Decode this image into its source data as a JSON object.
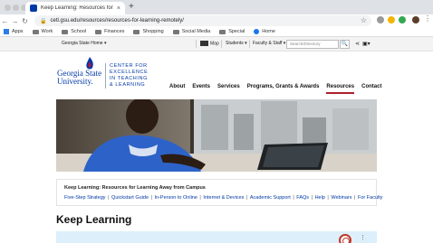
{
  "browser": {
    "tab_title": "Keep Learning: Resources for",
    "tab_close": "×",
    "new_tab": "+",
    "url": "cetl.gsu.edu/resources/resources-for-learning-remotely/",
    "nav": {
      "back": "←",
      "forward": "→",
      "reload": "↻"
    },
    "bookmarks": [
      {
        "label": "Apps",
        "icon": "apps-grid-icon"
      },
      {
        "label": "Work",
        "icon": "folder-icon"
      },
      {
        "label": "School",
        "icon": "folder-icon"
      },
      {
        "label": "Finances",
        "icon": "folder-icon"
      },
      {
        "label": "Shopping",
        "icon": "folder-icon"
      },
      {
        "label": "Social Media",
        "icon": "folder-icon"
      },
      {
        "label": "Special",
        "icon": "folder-icon"
      },
      {
        "label": "Home",
        "icon": "facebook-icon"
      }
    ]
  },
  "utility": {
    "gsu_home": "Georgia State Home ▾",
    "map": "Map",
    "students": "Students ▾",
    "faculty": "Faculty & Staff ▾",
    "search_placeholder": "Search/Directory",
    "search_icon": "🔍"
  },
  "logo": {
    "university": "Georgia State University.",
    "center_line1": "CENTER FOR",
    "center_line2": "EXCELLENCE",
    "center_line3": "IN TEACHING",
    "center_line4": "& LEARNING"
  },
  "nav": [
    "About",
    "Events",
    "Services",
    "Programs, Grants & Awards",
    "Resources",
    "Contact"
  ],
  "quick": {
    "title": "Keep Learning: Resources for Learning Away from Campus",
    "links": [
      "Five-Step Strategy",
      "Quickstart Guide",
      "In-Person to Online",
      "Internet & Devices",
      "Academic Support",
      "FAQs",
      "Help",
      "Webinars",
      "For Faculty"
    ]
  },
  "page_title": "Keep Learning",
  "colors": {
    "brand": "#0039a6",
    "accent": "#b01e2d",
    "callout": "#dceffa"
  }
}
